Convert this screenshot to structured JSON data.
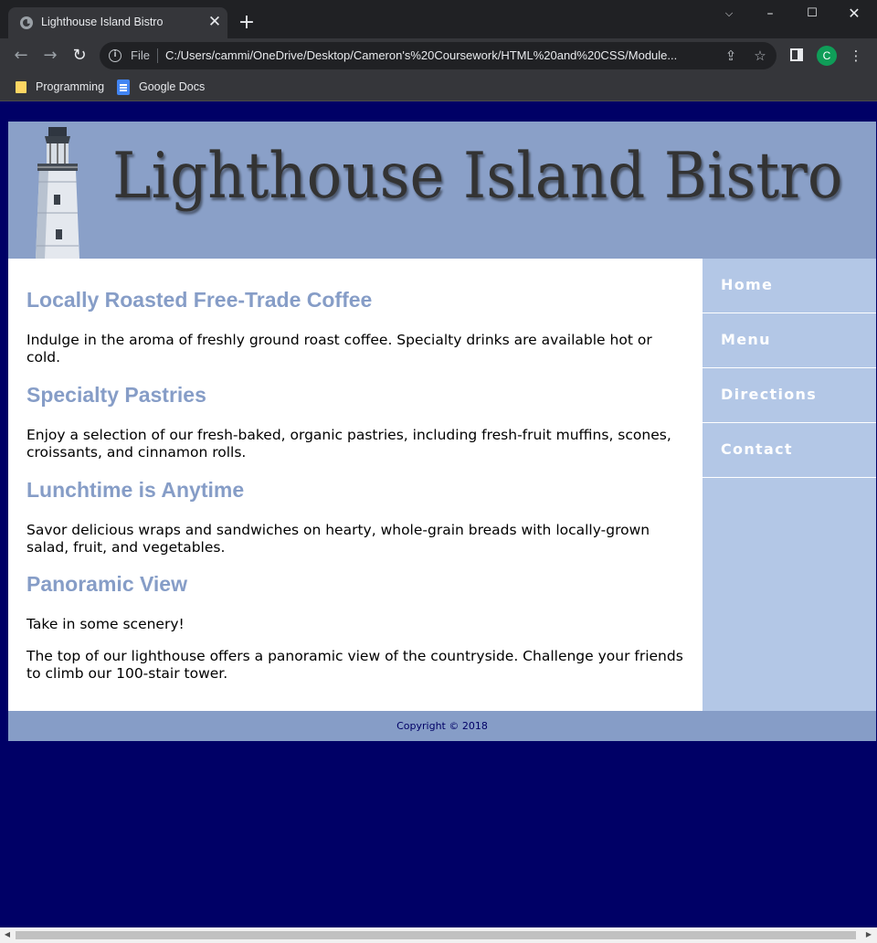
{
  "browser": {
    "tab_title": "Lighthouse Island Bistro",
    "address_prefix": "File",
    "url": "C:/Users/cammi/OneDrive/Desktop/Cameron's%20Coursework/HTML%20and%20CSS/Module...",
    "profile_initial": "C",
    "bookmarks": [
      {
        "label": "Programming",
        "icon": "folder-icon"
      },
      {
        "label": "Google Docs",
        "icon": "google-docs-icon"
      }
    ]
  },
  "site": {
    "banner_title": "Lighthouse Island Bistro",
    "sections": [
      {
        "heading": "Locally Roasted Free-Trade Coffee",
        "paragraphs": [
          "Indulge in the aroma of freshly ground roast coffee. Specialty drinks are available hot or cold."
        ]
      },
      {
        "heading": "Specialty Pastries",
        "paragraphs": [
          "Enjoy a selection of our fresh-baked, organic pastries, including fresh-fruit muffins, scones, croissants, and cinnamon rolls."
        ]
      },
      {
        "heading": "Lunchtime is Anytime",
        "paragraphs": [
          "Savor delicious wraps and sandwiches on hearty, whole-grain breads with locally-grown salad, fruit, and vegetables."
        ]
      },
      {
        "heading": "Panoramic View",
        "paragraphs": [
          "Take in some scenery!",
          "The top of our lighthouse offers a panoramic view of the countryside. Challenge your friends to climb our 100-stair tower."
        ]
      }
    ],
    "nav": [
      "Home",
      "Menu",
      "Directions",
      "Contact"
    ],
    "footer": "Copyright © 2018"
  },
  "colors": {
    "page_background": "#000066",
    "banner_background": "#8aa0c8",
    "heading": "#869dc7",
    "nav_background": "#b3c7e6",
    "footer_background": "#869dc7"
  }
}
